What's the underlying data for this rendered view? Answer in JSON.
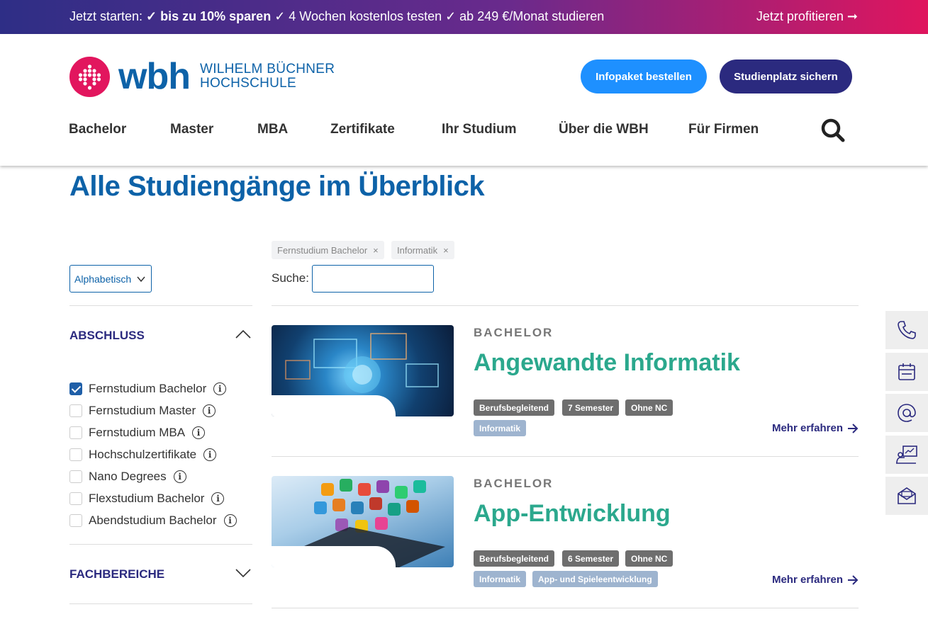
{
  "promo": {
    "prefix": "Jetzt starten: ",
    "highlight": "✓ bis zu 10% sparen",
    "rest": " ✓ 4 Wochen kostenlos testen ✓ ab 249 €/Monat studieren",
    "cta": "Jetzt profitieren ➞"
  },
  "header": {
    "logo_text": "wbh",
    "logo_name_line1": "WILHELM BÜCHNER",
    "logo_name_line2": "HOCHSCHULE",
    "btn_info": "Infopaket bestellen",
    "btn_place": "Studienplatz sichern",
    "nav": [
      "Bachelor",
      "Master",
      "MBA",
      "Zertifikate",
      "Ihr Studium",
      "Über die WBH",
      "Für Firmen"
    ]
  },
  "page": {
    "title": "Alle Studiengänge im Überblick"
  },
  "sidebar": {
    "sort_value": "Alphabetisch",
    "filter1_label": "ABSCHLUSS",
    "options": [
      {
        "label": "Fernstudium Bachelor",
        "checked": true
      },
      {
        "label": "Fernstudium Master",
        "checked": false
      },
      {
        "label": "Fernstudium MBA",
        "checked": false
      },
      {
        "label": "Hochschulzertifikate",
        "checked": false
      },
      {
        "label": "Nano Degrees",
        "checked": false
      },
      {
        "label": "Flexstudium Bachelor",
        "checked": false
      },
      {
        "label": "Abendstudium Bachelor",
        "checked": false
      }
    ],
    "info_glyph": "i",
    "filter2_label": "FACHBEREICHE"
  },
  "filters": {
    "chips": [
      "Fernstudium Bachelor",
      "Informatik"
    ],
    "chip_remove": "×",
    "search_label": "Suche:",
    "search_value": ""
  },
  "results": [
    {
      "category": "BACHELOR",
      "title": "Angewandte Informatik",
      "tags_dark": [
        "Berufsbegleitend",
        "7 Semester",
        "Ohne NC"
      ],
      "tags_light": [
        "Informatik"
      ],
      "more": "Mehr erfahren"
    },
    {
      "category": "BACHELOR",
      "title": "App-Entwicklung",
      "tags_dark": [
        "Berufsbegleitend",
        "6 Semester",
        "Ohne NC"
      ],
      "tags_light": [
        "Informatik",
        "App- und Spieleentwicklung"
      ],
      "more": "Mehr erfahren"
    }
  ],
  "side_contacts": [
    "phone-icon",
    "calendar-icon",
    "at-icon",
    "consultation-icon",
    "mail-icon"
  ],
  "colors": {
    "brand_blue": "#0d62a8",
    "brand_navy": "#2b2a7f",
    "brand_pink": "#e2165e",
    "accent_light_blue": "#1e90ff",
    "title_green": "#2ba88d"
  }
}
